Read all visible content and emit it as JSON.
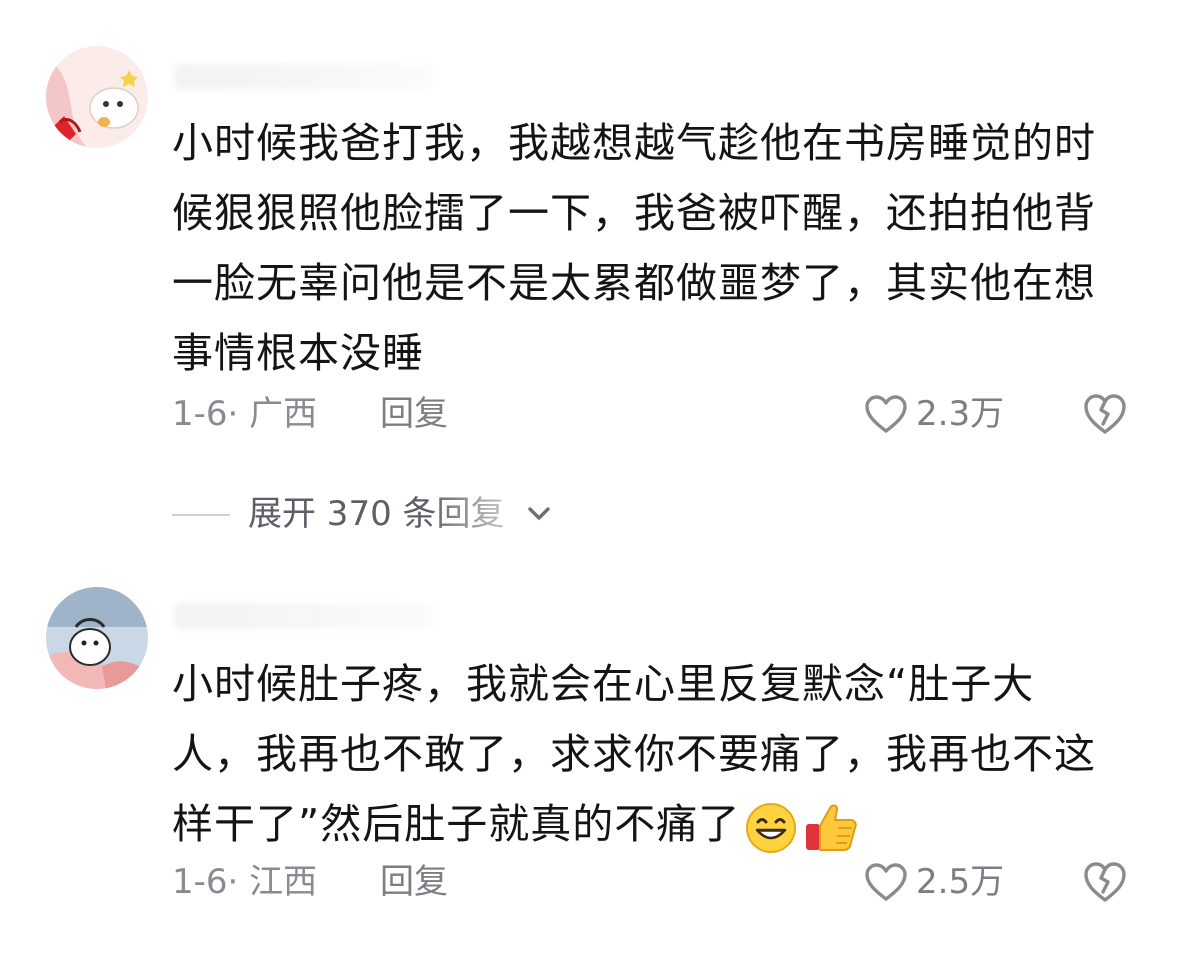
{
  "comments": [
    {
      "body_lines": [
        "小时候我爸打我，我越想越气趁他在书房睡觉的时",
        "候狠狠照他脸擂了一下，我爸被吓醒，还拍拍他背",
        "一脸无辜问他是不是太累都做噩梦了，其实他在想",
        "事情根本没睡"
      ],
      "date_location": "1-6· 广西",
      "reply_label": "回复",
      "like_count": "2.3万",
      "expand_replies": "展开 370 条回复"
    },
    {
      "body_lines": [
        "小时候肚子疼，我就会在心里反复默念“肚子大",
        "人，我再也不敢了，求求你不要痛了，我再也不这",
        "样干了”然后肚子就真的不痛了"
      ],
      "date_location": "1-6· 江西",
      "reply_label": "回复",
      "like_count": "2.5万",
      "emojis": [
        "grin-emoji",
        "thumbs-up-emoji"
      ]
    }
  ],
  "colors": {
    "text": "#141414",
    "meta": "#8a8b91",
    "icon_stroke": "#8a8b91"
  }
}
